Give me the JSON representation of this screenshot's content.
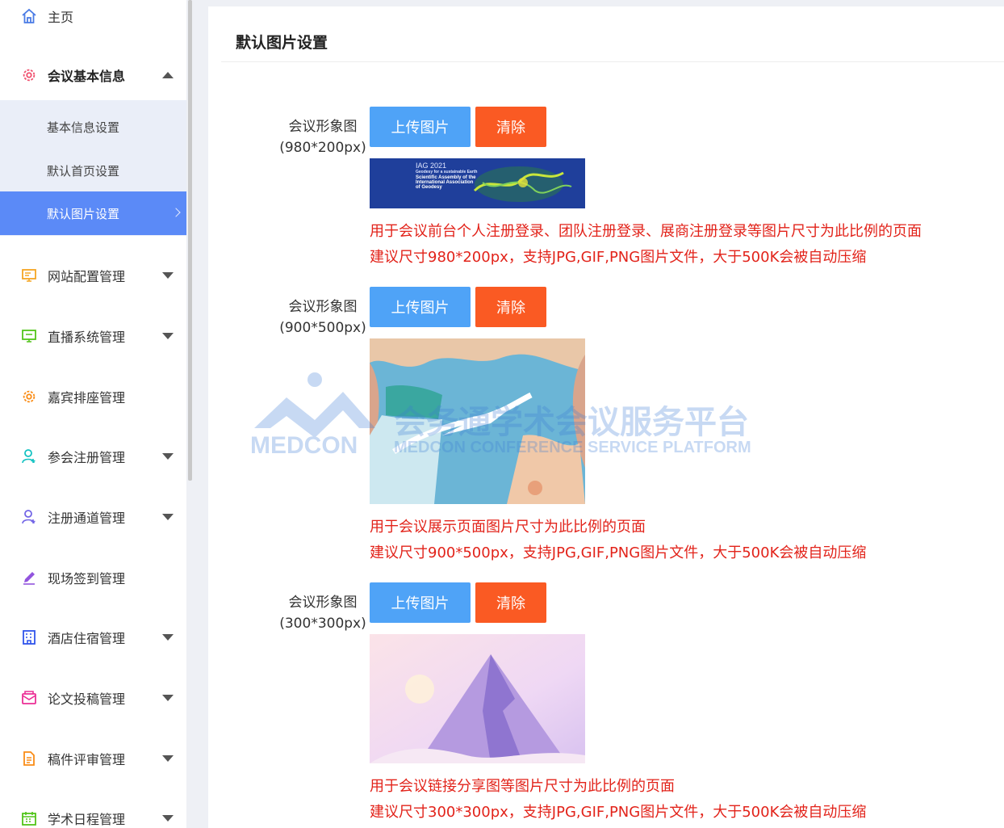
{
  "sidebar": {
    "home": "主页",
    "conference_info": {
      "label": "会议基本信息",
      "children": [
        "基本信息设置",
        "默认首页设置",
        "默认图片设置"
      ]
    },
    "menus": [
      {
        "label": "网站配置管理",
        "icon": "monitor-icon",
        "color": "#f5a623"
      },
      {
        "label": "直播系统管理",
        "icon": "screen-icon",
        "color": "#52c41a"
      },
      {
        "label": "嘉宾排座管理",
        "icon": "gear-icon",
        "color": "#fa8c16"
      },
      {
        "label": "参会注册管理",
        "icon": "user-add-icon",
        "color": "#13c2c2"
      },
      {
        "label": "注册通道管理",
        "icon": "user-add-icon",
        "color": "#7265e6"
      },
      {
        "label": "现场签到管理",
        "icon": "pen-icon",
        "color": "#9254de"
      },
      {
        "label": "酒店住宿管理",
        "icon": "building-icon",
        "color": "#2f54eb"
      },
      {
        "label": "论文投稿管理",
        "icon": "mail-icon",
        "color": "#eb2f96"
      },
      {
        "label": "稿件评审管理",
        "icon": "document-icon",
        "color": "#fa8c16"
      },
      {
        "label": "学术日程管理",
        "icon": "calendar-icon",
        "color": "#52c41a"
      }
    ]
  },
  "main": {
    "title": "默认图片设置",
    "upload_label": "上传图片",
    "clear_label": "清除",
    "fields": [
      {
        "label": "会议形象图",
        "size": "(980*200px)",
        "image_text": [
          "IAG 2021",
          "Geodesy for a sustainable Earth",
          "Scientific Assembly of the",
          "International Association",
          "of Geodesy"
        ],
        "note_line1": "用于会议前台个人注册登录、团队注册登录、展商注册登录等图片尺寸为此比例的页面",
        "note_line2": "建议尺寸980*200px，支持JPG,GIF,PNG图片文件，大于500K会被自动压缩"
      },
      {
        "label": "会议形象图",
        "size": "(900*500px)",
        "note_line1": "用于会议展示页面图片尺寸为此比例的页面",
        "note_line2": "建议尺寸900*500px，支持JPG,GIF,PNG图片文件，大于500K会被自动压缩"
      },
      {
        "label": "会议形象图",
        "size": "(300*300px)",
        "note_line1": "用于会议链接分享图等图片尺寸为此比例的页面",
        "note_line2": "建议尺寸300*300px，支持JPG,GIF,PNG图片文件，大于500K会被自动压缩"
      }
    ]
  },
  "watermark": {
    "logo": "MEDCON",
    "cn": "会务通学术会议服务平台",
    "en": "MEDCON CONFERENCE SERVICE PLATFORM"
  }
}
